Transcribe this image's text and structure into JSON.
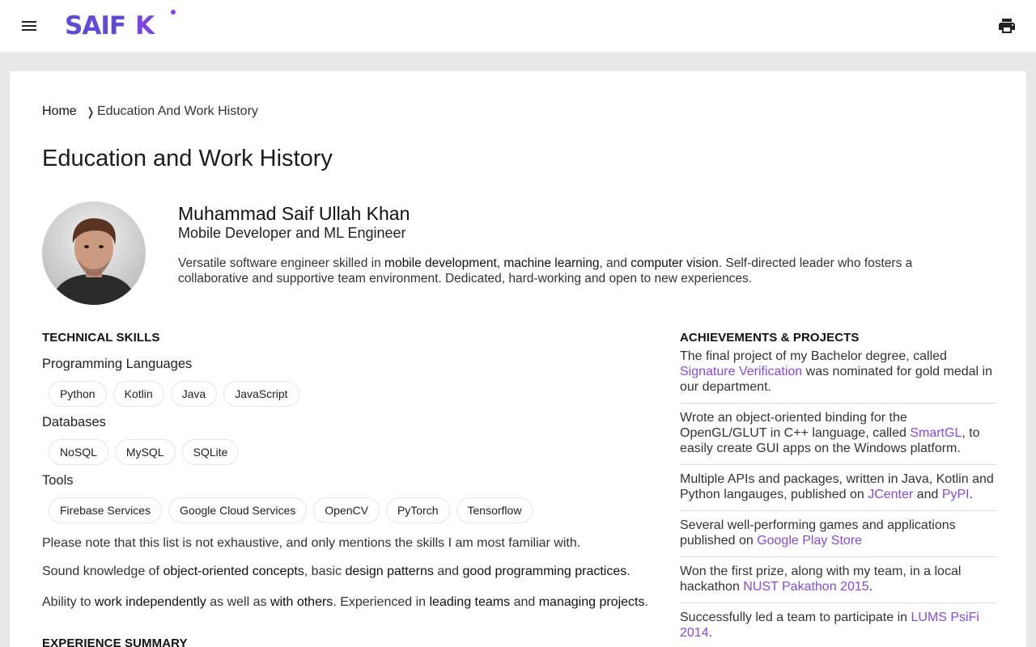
{
  "header": {
    "logo_main": "SAIF",
    "logo_letter": "K",
    "menu_icon": "menu-icon",
    "print_icon": "print-icon"
  },
  "breadcrumb": {
    "home": "Home",
    "separator": "❭",
    "current": "Education And Work History"
  },
  "page_title": "Education and Work History",
  "profile": {
    "name": "Muhammad Saif Ullah Khan",
    "role": "Mobile Developer and ML Engineer",
    "summary": {
      "t1": "Versatile software engineer skilled in ",
      "h1": "mobile development",
      "t2": ", ",
      "h2": "machine learning",
      "t3": ", and ",
      "h3": "computer vision",
      "t4": ". Self-directed leader who fosters a collaborative and supportive team environment. Dedicated, hard-working and open to new experiences."
    }
  },
  "skills": {
    "heading": "TECHNICAL SKILLS",
    "groups": [
      {
        "title": "Programming Languages",
        "items": [
          "Python",
          "Kotlin",
          "Java",
          "JavaScript"
        ]
      },
      {
        "title": "Databases",
        "items": [
          "NoSQL",
          "MySQL",
          "SQLite"
        ]
      },
      {
        "title": "Tools",
        "items": [
          "Firebase Services",
          "Google Cloud Services",
          "OpenCV",
          "PyTorch",
          "Tensorflow"
        ]
      }
    ],
    "note": "Please note that this list is not exhaustive, and only mentions the skills I am most familiar with.",
    "p1": {
      "t1": "Sound knowledge of ",
      "h1": "object-oriented concepts",
      "t2": ", basic ",
      "h2": "design patterns",
      "t3": " and ",
      "h3": "good programming practices",
      "t4": "."
    },
    "p2": {
      "t1": "Ability to ",
      "h1": "work independently",
      "t2": " as well as ",
      "h2": "with others",
      "t3": ". Experienced in ",
      "h3": "leading teams",
      "t4": " and ",
      "h4": "managing projects",
      "t5": "."
    }
  },
  "experience": {
    "heading": "EXPERIENCE SUMMARY"
  },
  "achievements": {
    "heading": "ACHIEVEMENTS & PROJECTS",
    "items": [
      {
        "t1": "The final project of my Bachelor degree, called ",
        "l1": "Signature Verification",
        "t2": " was nominated for gold medal in our department."
      },
      {
        "t1": "Wrote an object-oriented binding for the OpenGL/GLUT in C++ language, called ",
        "l1": "SmartGL",
        "t2": ", to easily create GUI apps on the Windows platform."
      },
      {
        "t1": "Multiple APIs and packages, written in Java, Kotlin and Python langauges, published on ",
        "l1": "JCenter",
        "t2": " and ",
        "l2": "PyPI",
        "t3": "."
      },
      {
        "t1": "Several well-performing games and applications published on ",
        "l1": "Google Play Store",
        "t2": ""
      },
      {
        "t1": "Won the first prize, along with my team, in a local hackathon ",
        "l1": "NUST Pakathon 2015",
        "t2": "."
      },
      {
        "t1": "Successfully led a team to participate in ",
        "l1": "LUMS PsiFi 2014",
        "t2": "."
      }
    ]
  },
  "colors": {
    "accent": "#8549e4",
    "logo": "#5f4bd8",
    "background": "#e8e8e8"
  }
}
